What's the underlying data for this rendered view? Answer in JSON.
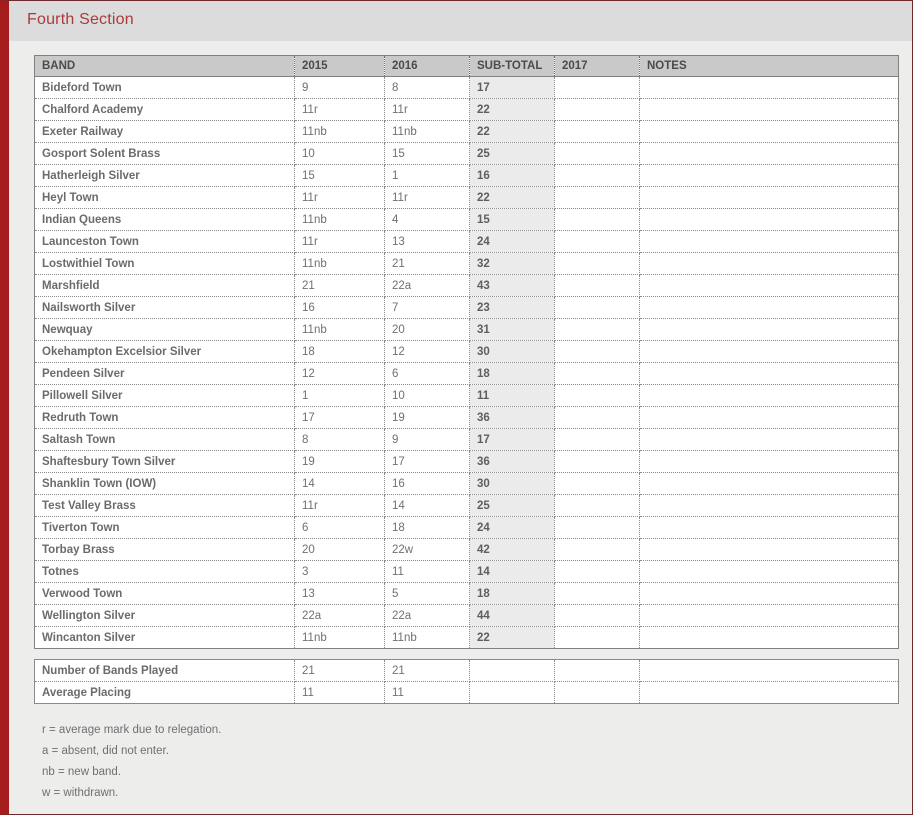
{
  "page": {
    "title": "Fourth Section",
    "accent_color": "#a83c3c",
    "frame_border_color": "#a61c1c",
    "title_band_color": "#dcdcdc",
    "content_bg_color": "#ededec"
  },
  "table": {
    "columns": [
      {
        "key": "band",
        "label": "BAND"
      },
      {
        "key": "y2015",
        "label": "2015"
      },
      {
        "key": "y2016",
        "label": "2016"
      },
      {
        "key": "subtotal",
        "label": "SUB-TOTAL"
      },
      {
        "key": "y2017",
        "label": "2017"
      },
      {
        "key": "notes",
        "label": "NOTES"
      }
    ],
    "rows": [
      {
        "band": "Bideford Town",
        "y2015": "9",
        "y2016": "8",
        "subtotal": "17",
        "y2017": "",
        "notes": ""
      },
      {
        "band": "Chalford Academy",
        "y2015": "11r",
        "y2016": "11r",
        "subtotal": "22",
        "y2017": "",
        "notes": ""
      },
      {
        "band": "Exeter Railway",
        "y2015": "11nb",
        "y2016": "11nb",
        "subtotal": "22",
        "y2017": "",
        "notes": ""
      },
      {
        "band": "Gosport Solent Brass",
        "y2015": "10",
        "y2016": "15",
        "subtotal": "25",
        "y2017": "",
        "notes": ""
      },
      {
        "band": "Hatherleigh Silver",
        "y2015": "15",
        "y2016": "1",
        "subtotal": "16",
        "y2017": "",
        "notes": ""
      },
      {
        "band": "Heyl Town",
        "y2015": "11r",
        "y2016": "11r",
        "subtotal": "22",
        "y2017": "",
        "notes": ""
      },
      {
        "band": "Indian Queens",
        "y2015": "11nb",
        "y2016": "4",
        "subtotal": "15",
        "y2017": "",
        "notes": ""
      },
      {
        "band": "Launceston Town",
        "y2015": "11r",
        "y2016": "13",
        "subtotal": "24",
        "y2017": "",
        "notes": ""
      },
      {
        "band": "Lostwithiel Town",
        "y2015": "11nb",
        "y2016": "21",
        "subtotal": "32",
        "y2017": "",
        "notes": ""
      },
      {
        "band": "Marshfield",
        "y2015": "21",
        "y2016": "22a",
        "subtotal": "43",
        "y2017": "",
        "notes": ""
      },
      {
        "band": "Nailsworth Silver",
        "y2015": "16",
        "y2016": "7",
        "subtotal": "23",
        "y2017": "",
        "notes": ""
      },
      {
        "band": "Newquay",
        "y2015": "11nb",
        "y2016": "20",
        "subtotal": "31",
        "y2017": "",
        "notes": ""
      },
      {
        "band": "Okehampton Excelsior Silver",
        "y2015": "18",
        "y2016": "12",
        "subtotal": "30",
        "y2017": "",
        "notes": ""
      },
      {
        "band": "Pendeen Silver",
        "y2015": "12",
        "y2016": "6",
        "subtotal": "18",
        "y2017": "",
        "notes": ""
      },
      {
        "band": "Pillowell Silver",
        "y2015": "1",
        "y2016": "10",
        "subtotal": "11",
        "y2017": "",
        "notes": ""
      },
      {
        "band": "Redruth Town",
        "y2015": "17",
        "y2016": "19",
        "subtotal": "36",
        "y2017": "",
        "notes": ""
      },
      {
        "band": "Saltash Town",
        "y2015": "8",
        "y2016": "9",
        "subtotal": "17",
        "y2017": "",
        "notes": ""
      },
      {
        "band": "Shaftesbury Town Silver",
        "y2015": "19",
        "y2016": "17",
        "subtotal": "36",
        "y2017": "",
        "notes": ""
      },
      {
        "band": "Shanklin Town (IOW)",
        "y2015": "14",
        "y2016": "16",
        "subtotal": "30",
        "y2017": "",
        "notes": ""
      },
      {
        "band": "Test Valley Brass",
        "y2015": "11r",
        "y2016": "14",
        "subtotal": "25",
        "y2017": "",
        "notes": ""
      },
      {
        "band": "Tiverton Town",
        "y2015": "6",
        "y2016": "18",
        "subtotal": "24",
        "y2017": "",
        "notes": ""
      },
      {
        "band": "Torbay Brass",
        "y2015": "20",
        "y2016": "22w",
        "subtotal": "42",
        "y2017": "",
        "notes": ""
      },
      {
        "band": "Totnes",
        "y2015": "3",
        "y2016": "11",
        "subtotal": "14",
        "y2017": "",
        "notes": ""
      },
      {
        "band": "Verwood Town",
        "y2015": "13",
        "y2016": "5",
        "subtotal": "18",
        "y2017": "",
        "notes": ""
      },
      {
        "band": "Wellington Silver",
        "y2015": "22a",
        "y2016": "22a",
        "subtotal": "44",
        "y2017": "",
        "notes": ""
      },
      {
        "band": "Wincanton Silver",
        "y2015": "11nb",
        "y2016": "11nb",
        "subtotal": "22",
        "y2017": "",
        "notes": ""
      }
    ]
  },
  "summary": {
    "rows": [
      {
        "band": "Number of Bands Played",
        "y2015": "21",
        "y2016": "21",
        "subtotal": "",
        "y2017": "",
        "notes": ""
      },
      {
        "band": "Average Placing",
        "y2015": "11",
        "y2016": "11",
        "subtotal": "",
        "y2017": "",
        "notes": ""
      }
    ]
  },
  "footnotes": [
    "r = average mark due to relegation.",
    "a = absent, did not enter.",
    "nb = new band.",
    "w = withdrawn."
  ]
}
